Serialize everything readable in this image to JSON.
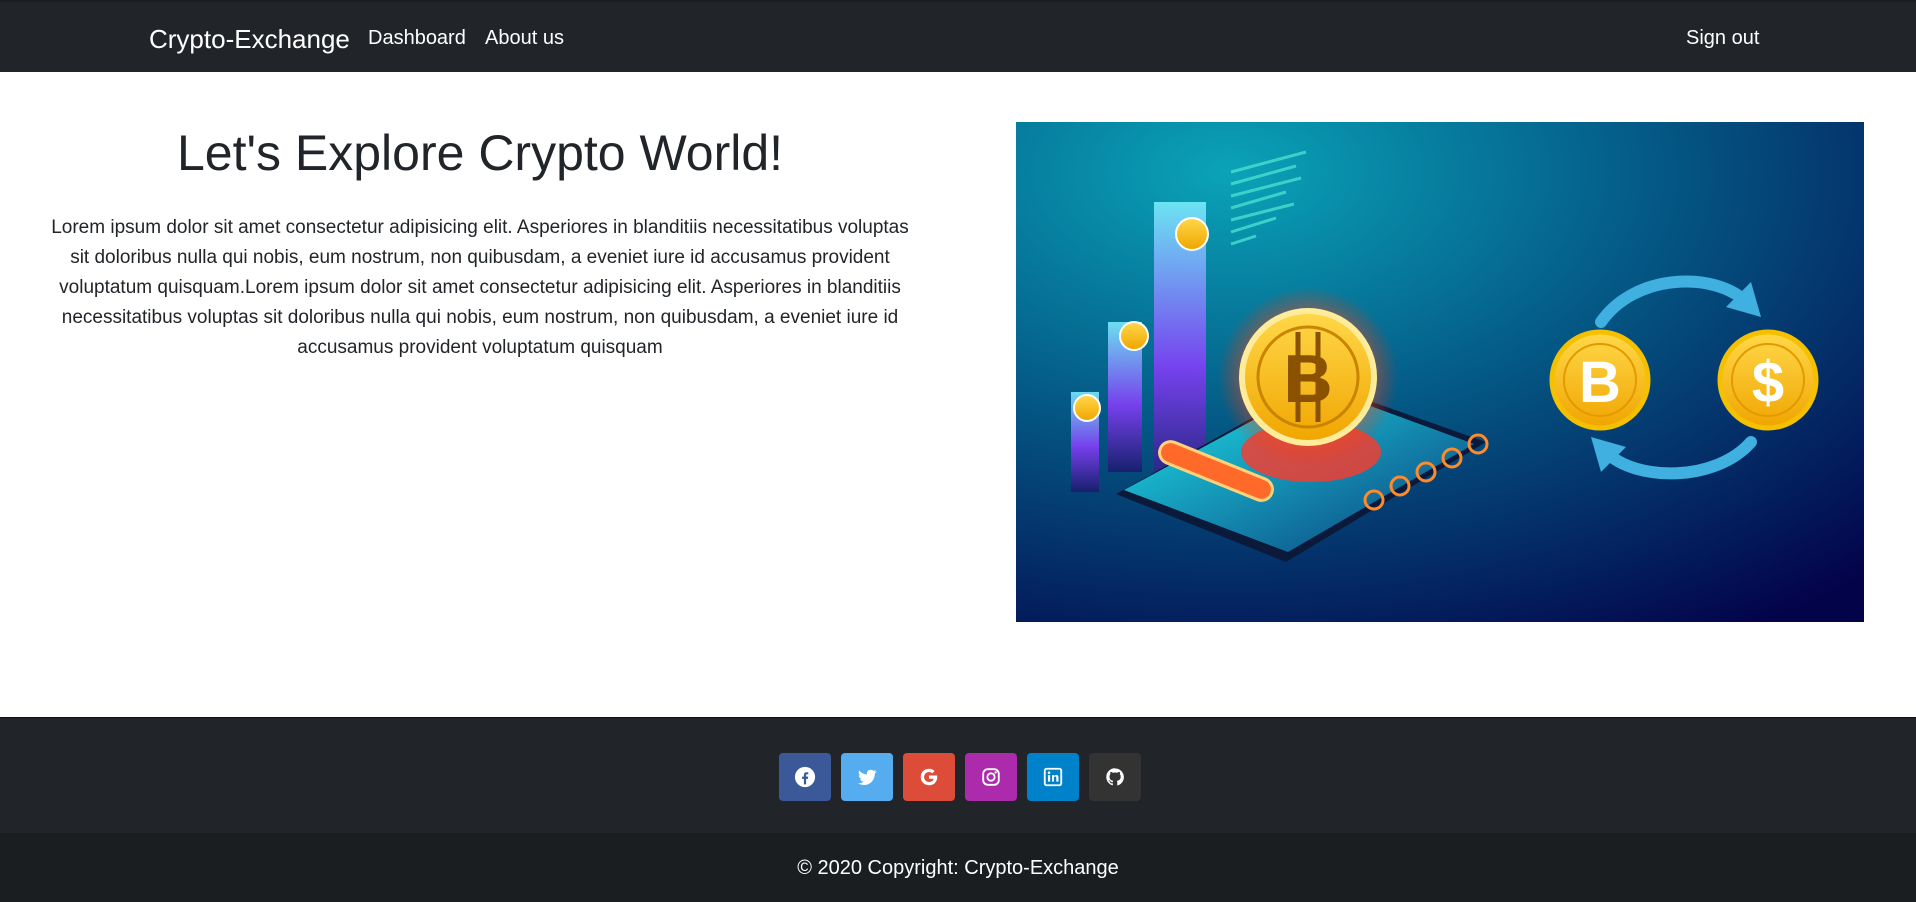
{
  "navbar": {
    "brand": "Crypto-Exchange",
    "links": [
      {
        "label": "Dashboard"
      },
      {
        "label": "About us"
      }
    ],
    "signout": "Sign out",
    "background": "#212529"
  },
  "hero": {
    "title": "Let's Explore Crypto World!",
    "text": "Lorem ipsum dolor sit amet consectetur adipisicing elit. Asperiores in blanditiis necessitatibus voluptas sit doloribus nulla qui nobis, eum nostrum, non quibusdam, a eveniet iure id accusamus provident voluptatum quisquam.Lorem ipsum dolor sit amet consectetur adipisicing elit. Asperiores in blanditiis necessitatibus voluptas sit doloribus nulla qui nobis, eum nostrum, non quibusdam, a eveniet iure id accusamus provident voluptatum quisquam",
    "image": {
      "icons": [
        "bitcoin-coin",
        "dollar-coin",
        "exchange-arrows",
        "smartphone",
        "bar-chart"
      ]
    }
  },
  "footer": {
    "social": [
      {
        "name": "facebook",
        "icon": "facebook-icon",
        "color": "#3b5998"
      },
      {
        "name": "twitter",
        "icon": "twitter-icon",
        "color": "#55acee"
      },
      {
        "name": "google",
        "icon": "google-icon",
        "color": "#dd4b39"
      },
      {
        "name": "instagram",
        "icon": "instagram-icon",
        "color": "#ac2bac"
      },
      {
        "name": "linkedin",
        "icon": "linkedin-icon",
        "color": "#0082ca"
      },
      {
        "name": "github",
        "icon": "github-icon",
        "color": "#333333"
      }
    ],
    "copyright": "© 2020 Copyright: Crypto-Exchange"
  }
}
